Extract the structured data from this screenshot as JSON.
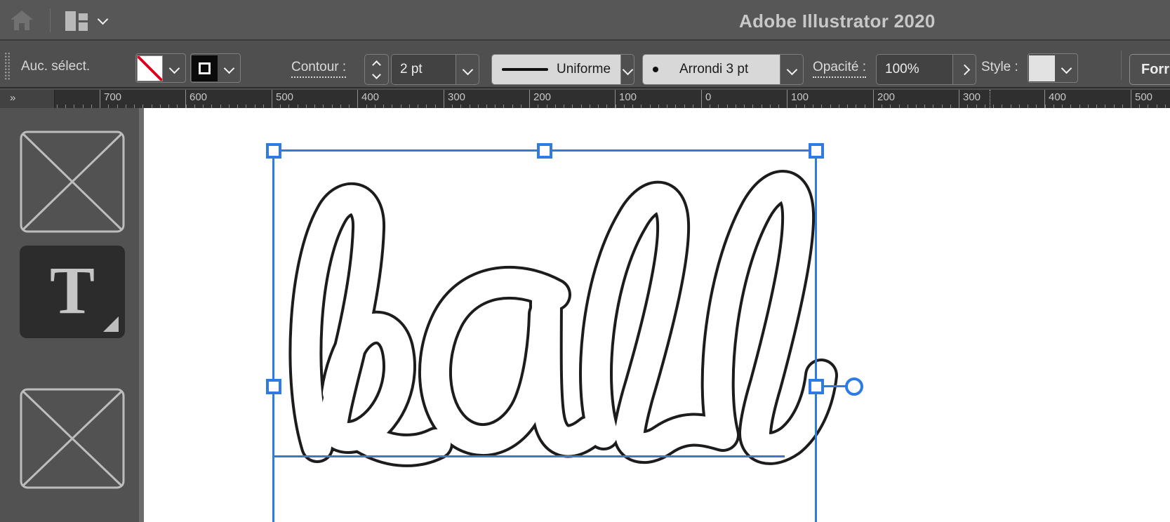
{
  "app": {
    "title": "Adobe Illustrator 2020"
  },
  "topbar": {
    "icons": {
      "home": "house",
      "workspace_switcher": "layout-rectangles",
      "workspace_chevron": "chevron-down"
    }
  },
  "control_bar": {
    "selection_status": "Auc. sélect.",
    "contour_label": "Contour :",
    "stroke_weight_value": "2 pt",
    "width_profile_value": "Uniforme",
    "brush_definition_value": "Arrondi 3 pt",
    "opacity_label": "Opacité :",
    "opacity_value": "100%",
    "style_label": "Style :",
    "shape_button_label": "Forr",
    "icons": {
      "fill_swatch": "none-fill (white with red slash)",
      "stroke_swatch": "black stroke ring",
      "dropdown_chevrons": "chevron-down",
      "stepper": "chevron-up / chevron-down",
      "opacity_expander": "chevron-right"
    }
  },
  "ruler": {
    "overflow_indicator": "»",
    "tick_labels": [
      "700",
      "600",
      "500",
      "400",
      "300",
      "200",
      "100",
      "0",
      "100",
      "200",
      "300",
      "400",
      "500"
    ]
  },
  "toolbar": {
    "type_tool_label": "T",
    "slots": [
      "empty-slot",
      "type-tool-selected",
      "empty-slot"
    ]
  },
  "canvas": {
    "lettering_text": "ball"
  },
  "colors": {
    "topbar_bg": "#575757",
    "controlbar_bg": "#4f4f4f",
    "ruler_bg": "#2f2f2f",
    "panel_bg": "#525252",
    "canvas_bg": "#ffffff",
    "accent_blue": "#2E7CE3",
    "none_fill_red": "#e1001e"
  }
}
